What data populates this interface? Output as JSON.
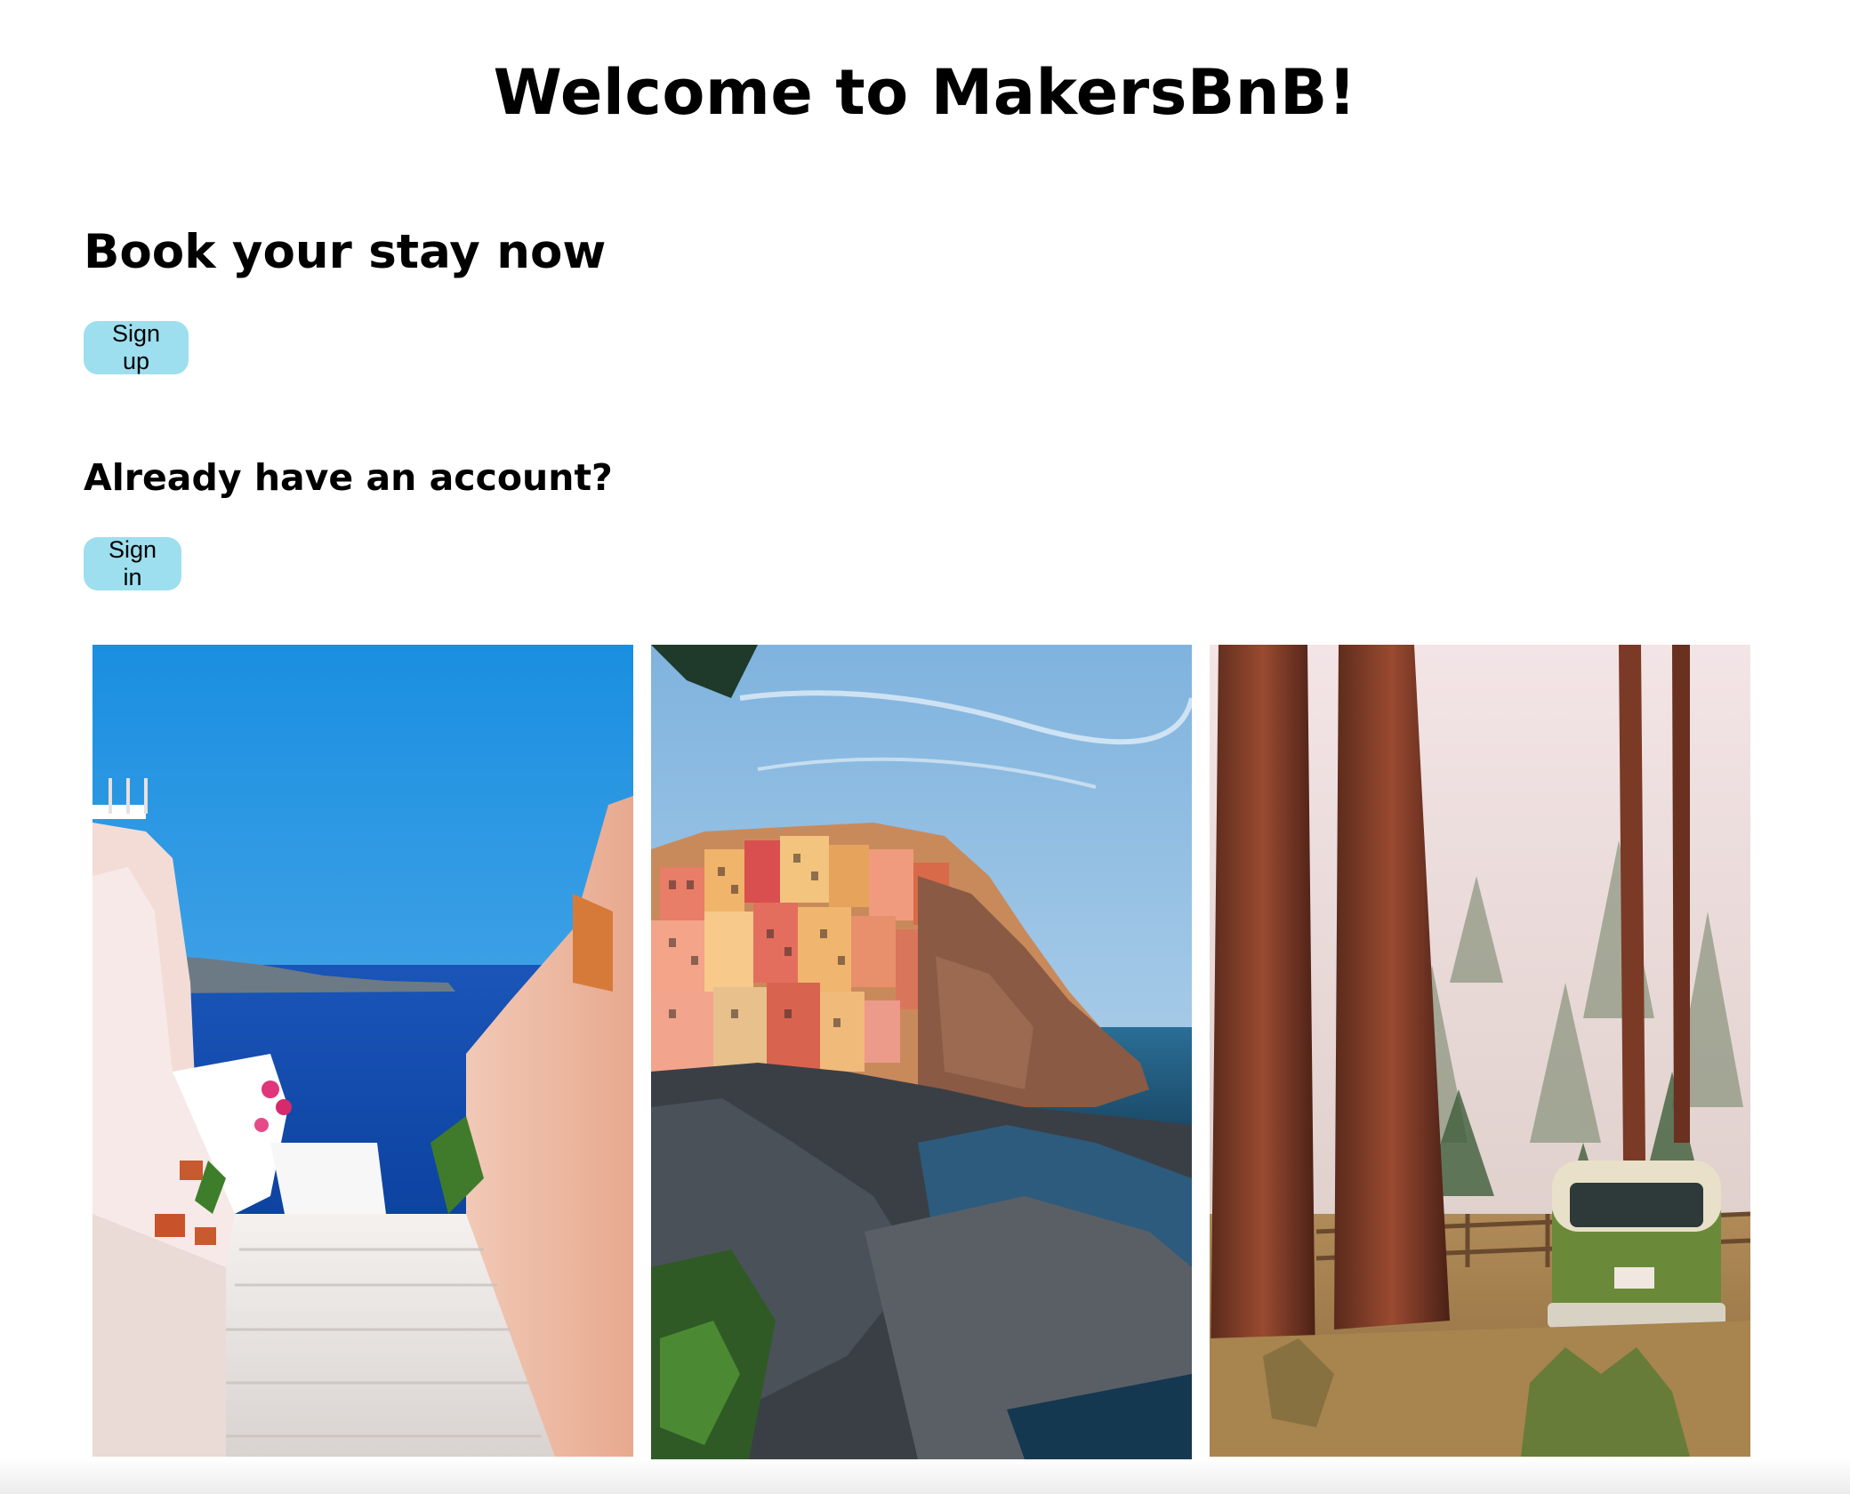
{
  "header": {
    "title": "Welcome to MakersBnB!"
  },
  "signup_section": {
    "heading": "Book your stay now",
    "button_label": "Sign up"
  },
  "signin_section": {
    "heading": "Already have an account?",
    "button_label": "Sign in"
  },
  "colors": {
    "button_bg": "#9ddfee"
  }
}
